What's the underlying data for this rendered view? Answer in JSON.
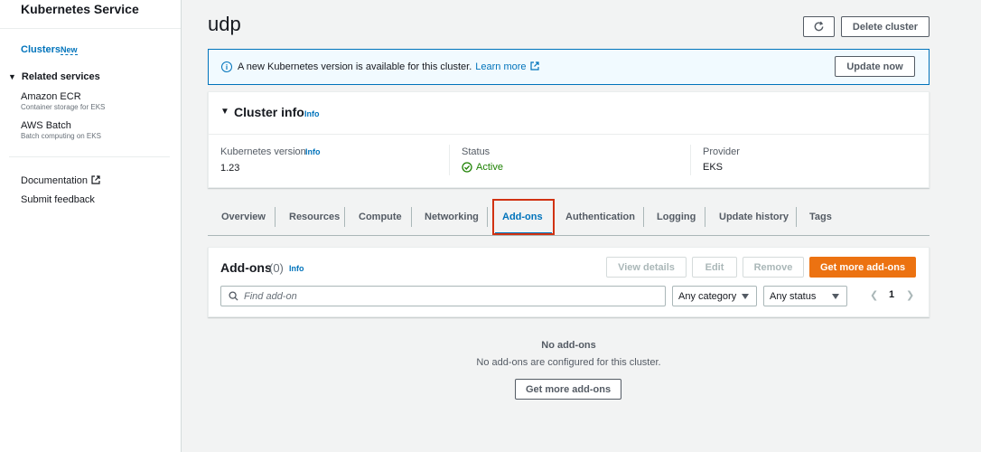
{
  "sidebar": {
    "title": "Kubernetes Service",
    "clusters_label": "Clusters",
    "clusters_badge": "New",
    "related_label": "Related services",
    "items": [
      {
        "label": "Amazon ECR",
        "sub": "Container storage for EKS"
      },
      {
        "label": "AWS Batch",
        "sub": "Batch computing on EKS"
      }
    ],
    "documentation": "Documentation",
    "feedback": "Submit feedback"
  },
  "header": {
    "title": "udp",
    "delete_label": "Delete cluster"
  },
  "banner": {
    "text": "A new Kubernetes version is available for this cluster.",
    "learn_more": "Learn more",
    "update_label": "Update now"
  },
  "cluster_info": {
    "title": "Cluster info",
    "info": "Info",
    "k8s_label": "Kubernetes version",
    "k8s_info": "Info",
    "k8s_value": "1.23",
    "status_label": "Status",
    "status_value": "Active",
    "provider_label": "Provider",
    "provider_value": "EKS"
  },
  "tabs": [
    "Overview",
    "Resources",
    "Compute",
    "Networking",
    "Add-ons",
    "Authentication",
    "Logging",
    "Update history",
    "Tags"
  ],
  "addons": {
    "title": "Add-ons",
    "count": "(0)",
    "info": "Info",
    "view_details": "View details",
    "edit": "Edit",
    "remove": "Remove",
    "get_more": "Get more add-ons",
    "search_placeholder": "Find add-on",
    "category": "Any category",
    "status": "Any status",
    "page": "1",
    "empty_title": "No add-ons",
    "empty_desc": "No add-ons are configured for this cluster.",
    "empty_button": "Get more add-ons"
  },
  "colors": {
    "link": "#0073bb",
    "primary": "#ec7211",
    "success": "#1d8102",
    "highlight": "#d13212"
  }
}
